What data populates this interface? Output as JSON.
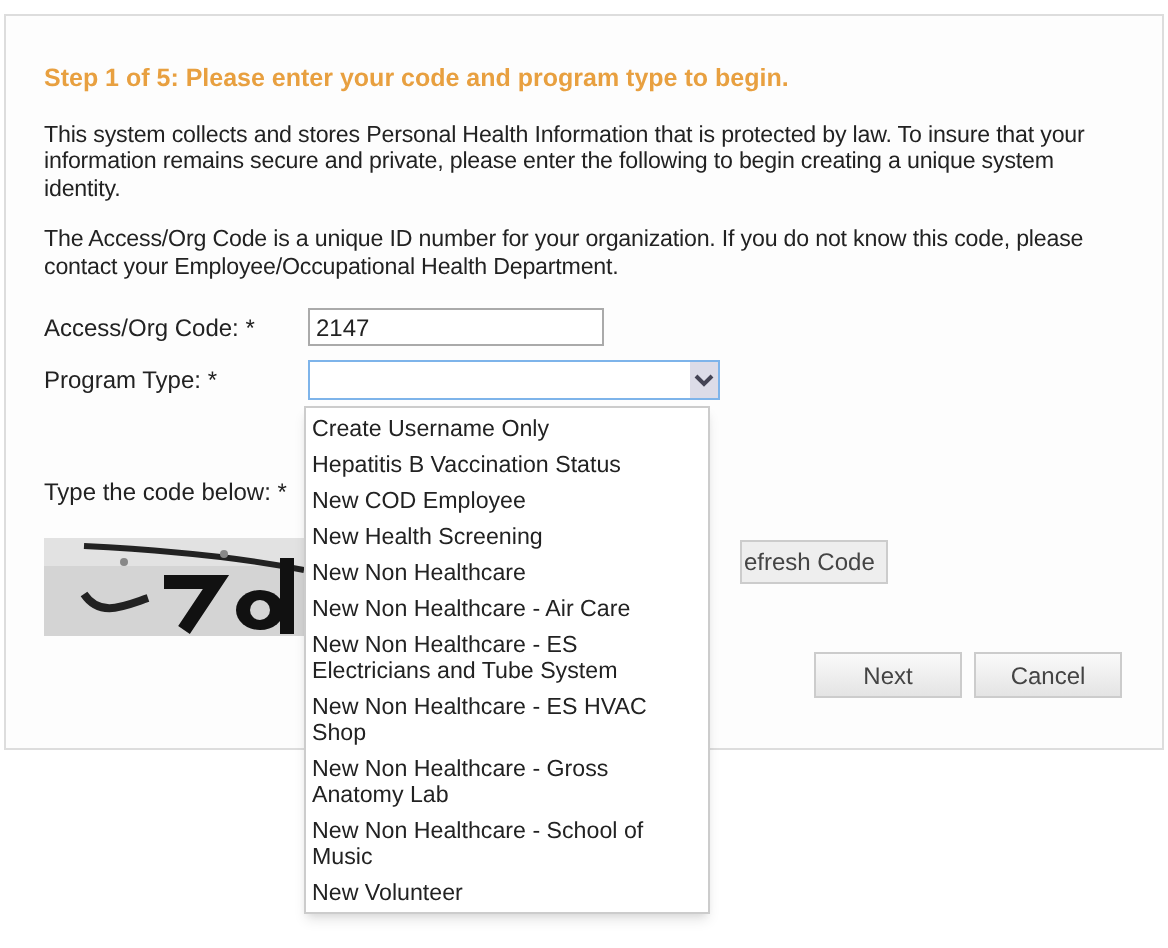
{
  "heading": "Step 1 of 5: Please enter your code and program type to begin.",
  "paragraphs": [
    "This system collects and stores Personal Health Information that is protected by law. To insure that your information remains secure and private, please enter the following to begin creating a unique system identity.",
    "The Access/Org Code is a unique ID number for your organization. If you do not know this code, please contact your Employee/Occupational Health Department."
  ],
  "access_code": {
    "label": "Access/Org Code: *",
    "value": "2147"
  },
  "program_type": {
    "label": "Program Type: *",
    "expanded": true,
    "options": [
      {
        "label": "Create Username Only"
      },
      {
        "label": "Hepatitis B Vaccination Status"
      },
      {
        "label": "New COD Employee"
      },
      {
        "label": "New Health Screening"
      },
      {
        "label": "New Non Healthcare"
      },
      {
        "label": "New Non Healthcare - Air Care"
      },
      {
        "label": "New Non Healthcare - ES Electricians and Tube System"
      },
      {
        "label": "New Non Healthcare - ES HVAC Shop"
      },
      {
        "label": "New Non Healthcare - Gross Anatomy Lab"
      },
      {
        "label": "New Non Healthcare - School of Music"
      },
      {
        "label": "New Volunteer"
      }
    ]
  },
  "captcha": {
    "label": "Type the code below: *",
    "refresh_button": "efresh Code"
  },
  "buttons": [
    "Next",
    "Cancel"
  ]
}
